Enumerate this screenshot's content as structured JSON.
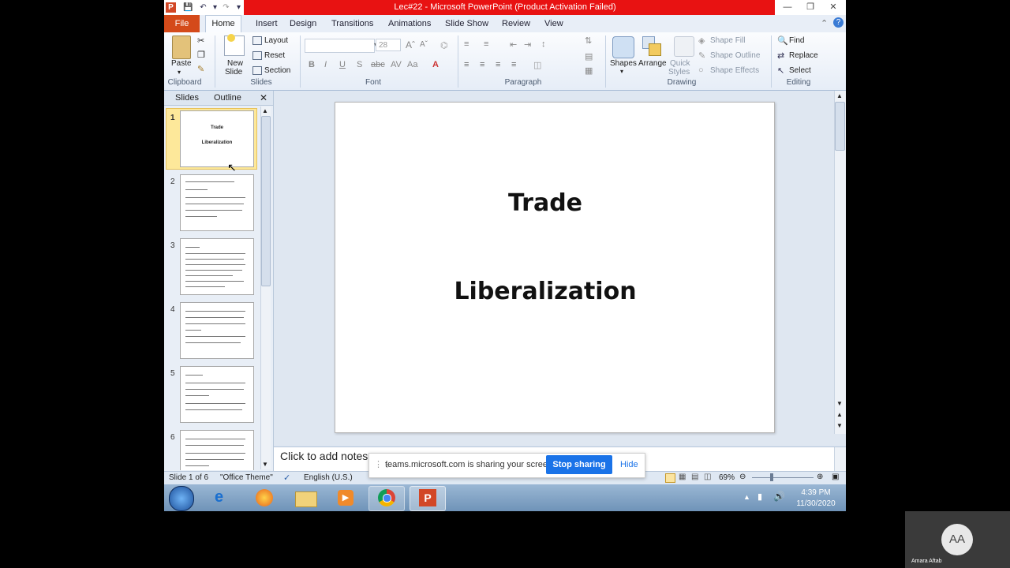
{
  "window": {
    "title": "Lec#22  -  Microsoft PowerPoint (Product Activation Failed)"
  },
  "tabs": [
    "File",
    "Home",
    "Insert",
    "Design",
    "Transitions",
    "Animations",
    "Slide Show",
    "Review",
    "View"
  ],
  "ribbon": {
    "clipboard": {
      "paste": "Paste",
      "group": "Clipboard"
    },
    "slides": {
      "new_slide_1": "New",
      "new_slide_2": "Slide",
      "layout": "Layout",
      "reset": "Reset",
      "section": "Section",
      "group": "Slides"
    },
    "font": {
      "font_name": "",
      "font_size": "28",
      "group": "Font"
    },
    "paragraph": {
      "group": "Paragraph"
    },
    "drawing": {
      "shapes": "Shapes",
      "arrange": "Arrange",
      "quick_styles_1": "Quick",
      "quick_styles_2": "Styles",
      "shape_fill": "Shape Fill",
      "shape_outline": "Shape Outline",
      "shape_effects": "Shape Effects",
      "group": "Drawing"
    },
    "editing": {
      "find": "Find",
      "replace": "Replace",
      "select": "Select",
      "group": "Editing"
    }
  },
  "pane": {
    "tabs": [
      "Slides",
      "Outline"
    ],
    "thumb1": {
      "title": "Trade",
      "subtitle": "Liberalization"
    },
    "numbers": [
      "1",
      "2",
      "3",
      "4",
      "5",
      "6"
    ]
  },
  "slide": {
    "title": "Trade",
    "subtitle": "Liberalization"
  },
  "notes": {
    "placeholder": "Click to add notes"
  },
  "share_bar": {
    "message": "teams.microsoft.com is sharing your screen.",
    "stop": "Stop sharing",
    "hide": "Hide"
  },
  "status": {
    "slide_info": "Slide 1 of 6",
    "theme": "\"Office Theme\"",
    "language": "English (U.S.)",
    "zoom": "69%"
  },
  "taskbar": {
    "time": "4:39 PM",
    "date": "11/30/2020"
  },
  "participant": {
    "initials": "AA",
    "name": "Amara Aftab"
  }
}
